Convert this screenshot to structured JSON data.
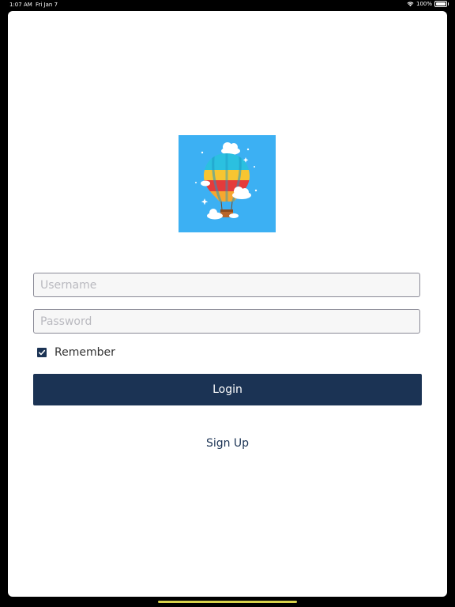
{
  "status_bar": {
    "time": "1:07 AM",
    "date": "Fri Jan 7",
    "battery": "100%",
    "wifi_icon": "wifi-icon",
    "battery_icon": "battery-icon"
  },
  "logo": {
    "icon": "hot-air-balloon-icon",
    "background": "#3cb0f3"
  },
  "form": {
    "username": {
      "value": "",
      "placeholder": "Username"
    },
    "password": {
      "value": "",
      "placeholder": "Password"
    },
    "remember": {
      "label": "Remember",
      "checked": true
    },
    "login_label": "Login",
    "signup_label": "Sign Up"
  },
  "colors": {
    "primary": "#1b3354",
    "field_border": "#8a8a96",
    "field_background": "#f7f7f7"
  }
}
